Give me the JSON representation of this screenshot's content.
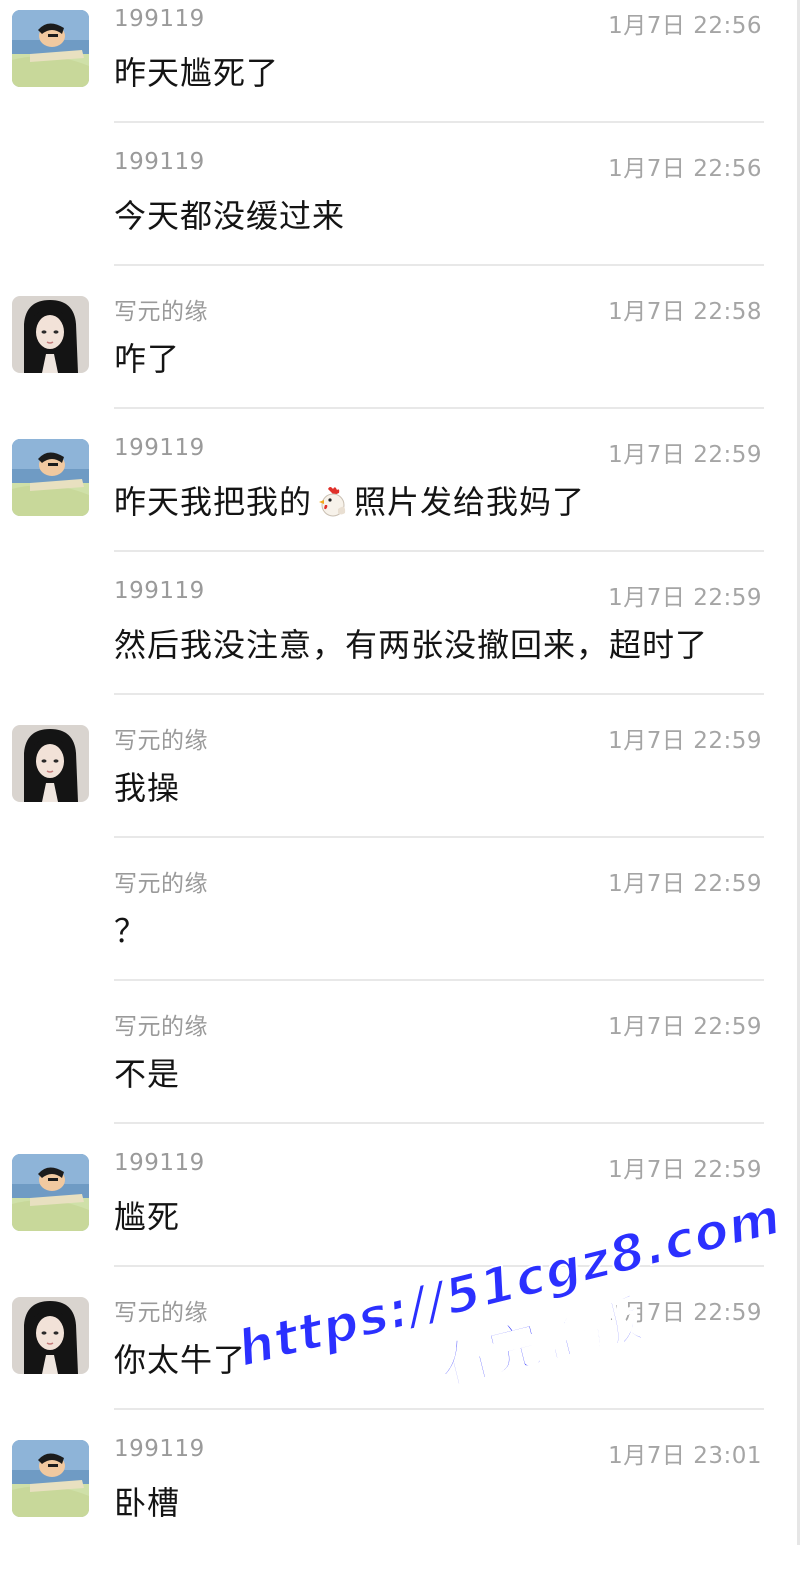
{
  "senders": {
    "a": "199119",
    "b": "写元的缘"
  },
  "avatars": {
    "a": "cartoon-man-avatar",
    "b": "girl-photo-avatar"
  },
  "messages": [
    {
      "sender": "199119",
      "time": "1月7日 22:56",
      "text": "昨天尴死了",
      "avatar": "a"
    },
    {
      "sender": "199119",
      "time": "1月7日 22:56",
      "text": "今天都没缓过来",
      "avatar": null
    },
    {
      "sender": "写元的缘",
      "time": "1月7日 22:58",
      "text": "咋了",
      "avatar": "b"
    },
    {
      "sender": "199119",
      "time": "1月7日 22:59",
      "text_before": "昨天我把我的",
      "emoji": "rooster-emoji",
      "text_after": "照片发给我妈了",
      "avatar": "a"
    },
    {
      "sender": "199119",
      "time": "1月7日 22:59",
      "text": "然后我没注意，有两张没撤回来，超时了",
      "avatar": null
    },
    {
      "sender": "写元的缘",
      "time": "1月7日 22:59",
      "text": "我操",
      "avatar": "b"
    },
    {
      "sender": "写元的缘",
      "time": "1月7日 22:59",
      "text": "？",
      "avatar": null
    },
    {
      "sender": "写元的缘",
      "time": "1月7日 22:59",
      "text": "不是",
      "avatar": null
    },
    {
      "sender": "199119",
      "time": "1月7日 22:59",
      "text": "尴死",
      "avatar": "a"
    },
    {
      "sender": "写元的缘",
      "time": "1月7日 22:59",
      "text": "你太牛了",
      "avatar": "b"
    },
    {
      "sender": "199119",
      "time": "1月7日 23:01",
      "text": "卧槽",
      "avatar": "a"
    }
  ],
  "watermark": {
    "url": "https://51cgz8.com",
    "cta": "看完整版"
  },
  "colors": {
    "watermark": "#2b30ff",
    "divider": "#e8e8e8",
    "meta_text": "#9a9a9a"
  }
}
